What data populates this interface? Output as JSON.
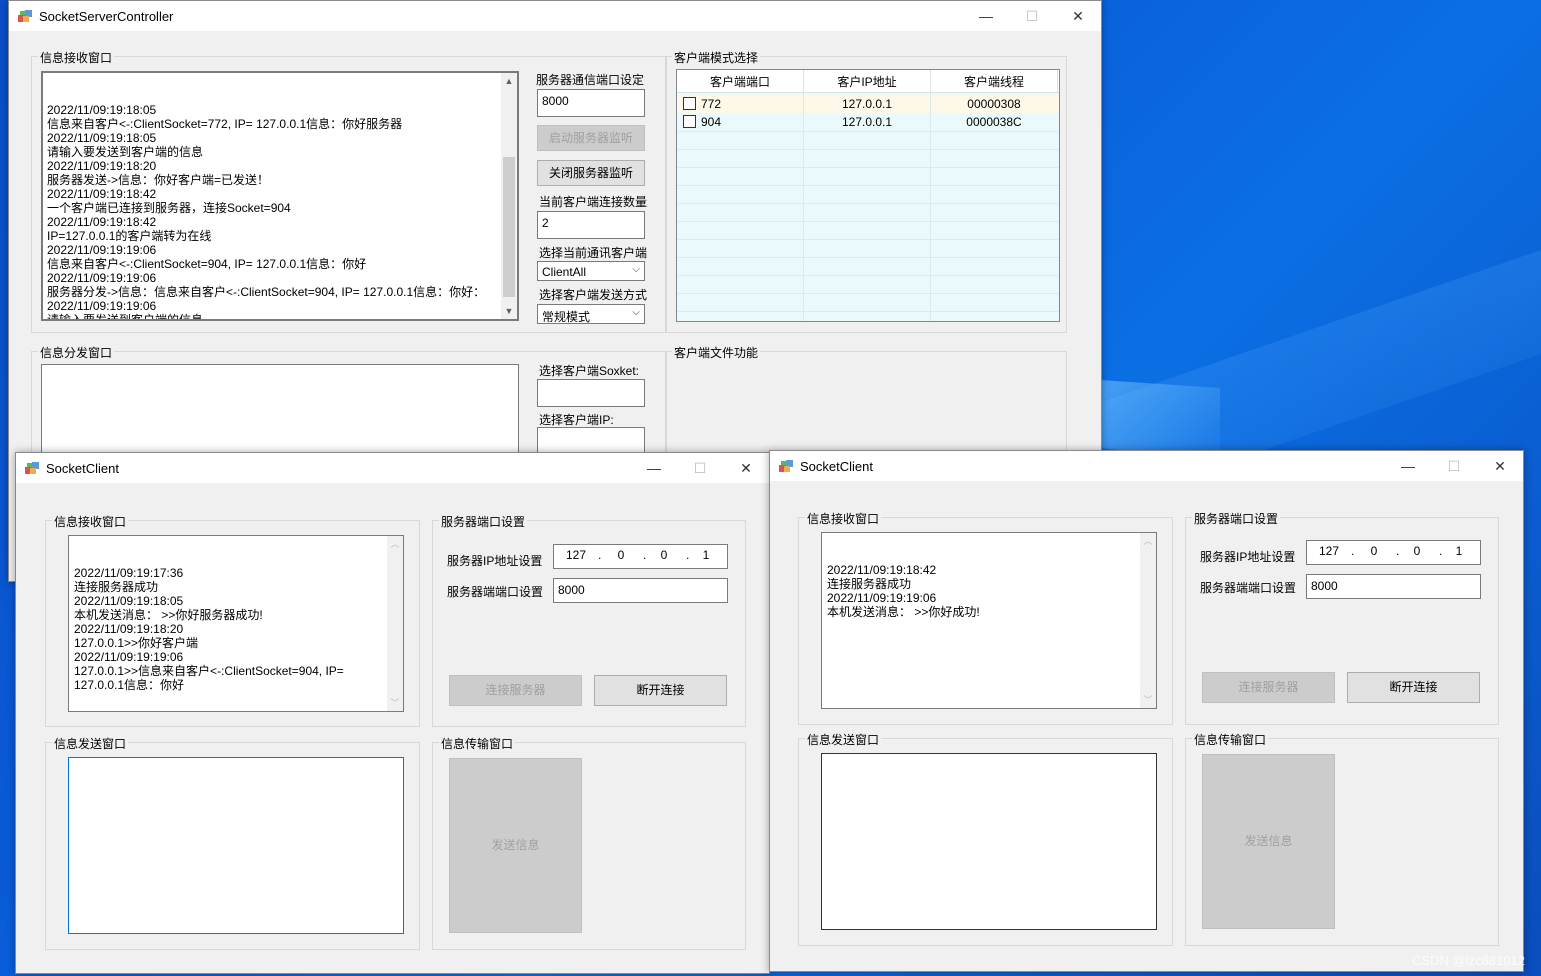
{
  "server": {
    "title": "SocketServerController",
    "minimize": "—",
    "maximize": "☐",
    "close": "✕",
    "recv_group": "信息接收窗口",
    "log": [
      "2022/11/09:19:18:05",
      "信息来自客户<-:ClientSocket=772, IP= 127.0.0.1信息：你好服务器",
      "2022/11/09:19:18:05",
      "请输入要发送到客户端的信息",
      "2022/11/09:19:18:20",
      "服务器发送->信息：你好客户端=已发送！",
      "2022/11/09:19:18:42",
      "一个客户端已连接到服务器，连接Socket=904",
      "2022/11/09:19:18:42",
      "IP=127.0.0.1的客户端转为在线",
      "2022/11/09:19:19:06",
      "信息来自客户<-:ClientSocket=904, IP= 127.0.0.1信息：你好",
      "2022/11/09:19:19:06",
      "服务器分发->信息：信息来自客户<-:ClientSocket=904, IP= 127.0.0.1信息：你好：",
      "2022/11/09:19:19:06",
      "请输入要发送到客户端的信息"
    ],
    "port_label": "服务器通信端口设定",
    "port_value": "8000",
    "start_btn": "启动服务器监听",
    "stop_btn": "关闭服务器监听",
    "count_label": "当前客户端连接数量",
    "count_value": "2",
    "select_client_label": "选择当前通讯客户端",
    "select_client_value": "ClientAll",
    "send_mode_label": "选择客户端发送方式",
    "send_mode_value": "常规模式",
    "mode_group": "客户端模式选择",
    "grid_headers": [
      "客户端端口",
      "客户IP地址",
      "客户端线程"
    ],
    "grid_rows": [
      {
        "port": "772",
        "ip": "127.0.0.1",
        "thread": "00000308"
      },
      {
        "port": "904",
        "ip": "127.0.0.1",
        "thread": "0000038C"
      }
    ],
    "dist_group": "信息分发窗口",
    "socket_label": "选择客户端Soxket:",
    "ip_label": "选择客户端IP:",
    "file_group": "客户端文件功能"
  },
  "client1": {
    "title": "SocketClient",
    "recv_group": "信息接收窗口",
    "log": [
      "2022/11/09:19:17:36",
      "连接服务器成功",
      "2022/11/09:19:18:05",
      "本机发送消息： >>你好服务器成功!",
      "2022/11/09:19:18:20",
      "127.0.0.1>>你好客户端",
      "2022/11/09:19:19:06",
      "127.0.0.1>>信息来自客户<-:ClientSocket=904, IP=",
      "127.0.0.1信息：你好"
    ],
    "port_group": "服务器端口设置",
    "ip_label": "服务器IP地址设置",
    "ip": [
      "127",
      "0",
      "0",
      "1"
    ],
    "port_label": "服务器端端口设置",
    "port_value": "8000",
    "connect_btn": "连接服务器",
    "disconnect_btn": "断开连接",
    "send_group": "信息发送窗口",
    "transfer_group": "信息传输窗口",
    "send_btn": "发送信息"
  },
  "client2": {
    "title": "SocketClient",
    "recv_group": "信息接收窗口",
    "log": [
      "2022/11/09:19:18:42",
      "连接服务器成功",
      "2022/11/09:19:19:06",
      "本机发送消息： >>你好成功!"
    ],
    "port_group": "服务器端口设置",
    "ip_label": "服务器IP地址设置",
    "ip": [
      "127",
      "0",
      "0",
      "1"
    ],
    "port_label": "服务器端端口设置",
    "port_value": "8000",
    "connect_btn": "连接服务器",
    "disconnect_btn": "断开连接",
    "send_group": "信息发送窗口",
    "transfer_group": "信息传输窗口",
    "send_btn": "发送信息"
  },
  "watermark": "CSDN @lzc881012"
}
